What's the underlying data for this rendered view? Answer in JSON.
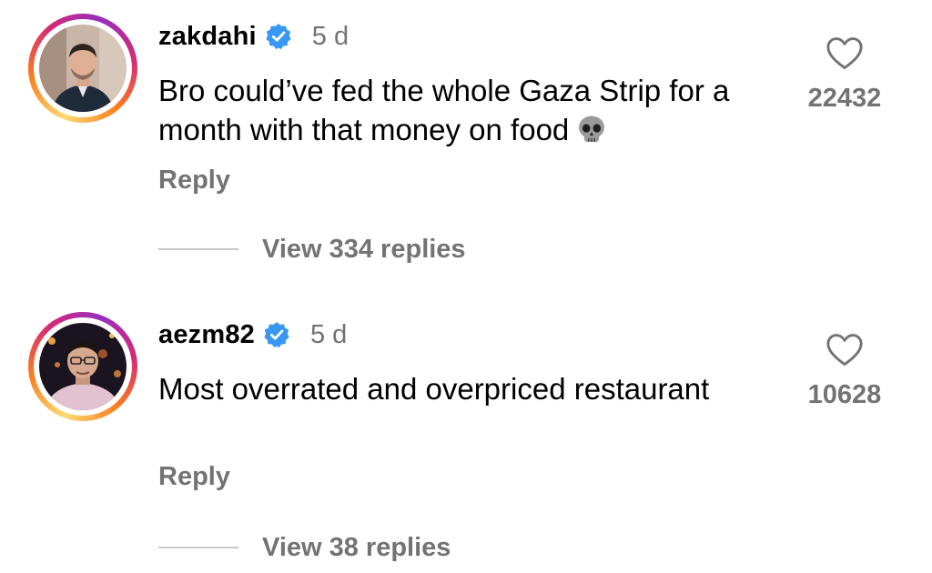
{
  "colors": {
    "verified_badge": "#3897f0",
    "secondary_text": "#737373",
    "divider": "#c7c7c7"
  },
  "comments": [
    {
      "username": "zakdahi",
      "verified": true,
      "time": "5 d",
      "text": "Bro could’ve fed the whole Gaza Strip for a month with that money on food",
      "emoji": "skull",
      "likes": "22432",
      "reply_label": "Reply",
      "view_replies_label": "View 334 replies",
      "like_icon": "heart-outline-icon"
    },
    {
      "username": "aezm82",
      "verified": true,
      "time": "5 d",
      "text": "Most overrated and overpriced restaurant",
      "likes": "10628",
      "reply_label": "Reply",
      "view_replies_label": "View 38 replies",
      "like_icon": "heart-outline-icon"
    }
  ]
}
